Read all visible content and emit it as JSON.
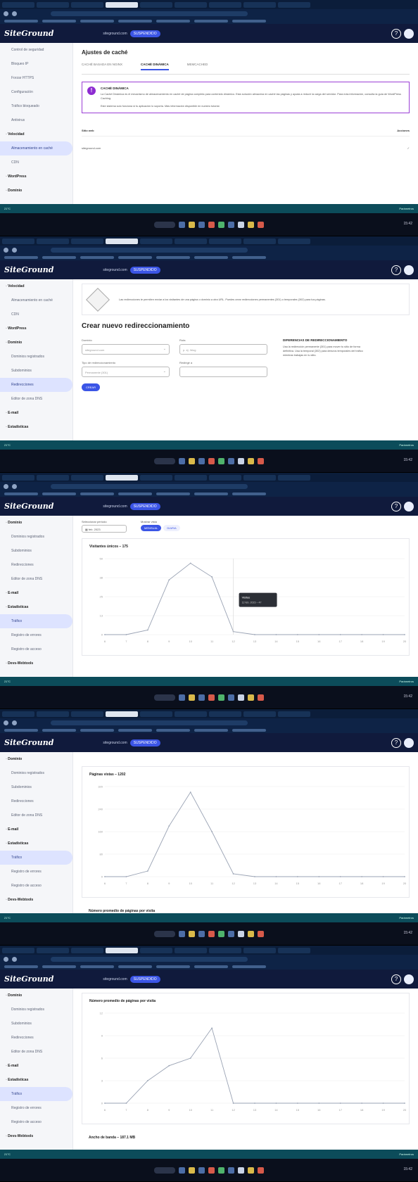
{
  "app": {
    "logo": "SiteGround",
    "site": "siteground.com",
    "site_badge": "SUSPENDIDO"
  },
  "taskbar": {
    "left_label": "21°C",
    "right_label": "Parámetros",
    "clock": "15:42"
  },
  "sidebar_frame1": [
    {
      "label": "Control de seguridad",
      "type": "item"
    },
    {
      "label": "Bloqueo IP",
      "type": "item"
    },
    {
      "label": "Forzar HTTPS",
      "type": "item"
    },
    {
      "label": "Configuración",
      "type": "item"
    },
    {
      "label": "Tráfico bloqueado",
      "type": "item"
    },
    {
      "label": "Antivirus",
      "type": "item"
    },
    {
      "label": "Velocidad",
      "type": "sec"
    },
    {
      "label": "Almacenamiento en caché",
      "type": "active"
    },
    {
      "label": "CDN",
      "type": "item"
    },
    {
      "label": "WordPress",
      "type": "sec"
    },
    {
      "label": "Dominio",
      "type": "sec"
    }
  ],
  "sidebar_frame2": [
    {
      "label": "Velocidad",
      "type": "sec"
    },
    {
      "label": "Almacenamiento en caché",
      "type": "item"
    },
    {
      "label": "CDN",
      "type": "item"
    },
    {
      "label": "WordPress",
      "type": "sec"
    },
    {
      "label": "Dominio",
      "type": "sec"
    },
    {
      "label": "Dominios registrados",
      "type": "item"
    },
    {
      "label": "Subdominios",
      "type": "item"
    },
    {
      "label": "Redirecciones",
      "type": "active"
    },
    {
      "label": "Editor de zona DNS",
      "type": "item"
    },
    {
      "label": "E-mail",
      "type": "sec"
    },
    {
      "label": "Estadísticas",
      "type": "sec"
    }
  ],
  "sidebar_stats": [
    {
      "label": "Dominio",
      "type": "sec"
    },
    {
      "label": "Dominios registrados",
      "type": "item"
    },
    {
      "label": "Subdominios",
      "type": "item"
    },
    {
      "label": "Redirecciones",
      "type": "item"
    },
    {
      "label": "Editor de zona DNS",
      "type": "item"
    },
    {
      "label": "E-mail",
      "type": "sec"
    },
    {
      "label": "Estadísticas",
      "type": "sec"
    },
    {
      "label": "Tráfico",
      "type": "active"
    },
    {
      "label": "Registro de errores",
      "type": "item"
    },
    {
      "label": "Registro de acceso",
      "type": "item"
    },
    {
      "label": "Devs-Webtools",
      "type": "sec"
    }
  ],
  "cache": {
    "title": "Ajustes de caché",
    "tabs": [
      "CACHÉ BASADA EN NGINX",
      "CACHÉ DINÁMICA",
      "MEMCACHED"
    ],
    "notice_title": "CACHÉ DINÁMICA",
    "notice_text": "La Caché Dinámica es el mecanismo de almacenamiento en caché de página completa para contenido dinámico. Esta solución almacena en caché las páginas y ayuda a reducir la carga del servidor. Para más información, consulta la guía de WordPress Caching.",
    "notice_text2": "Este sistema solo funciona si tu aplicación lo soporta. Más información disponible en nuestro tutorial.",
    "table_headers": [
      "Sitio web",
      "Acciones"
    ],
    "row": "siteground.com"
  },
  "redirect": {
    "banner_text": "Las redirecciones te permiten enviar a los visitantes de una página o dominio a otra URL. Puedes crear redirecciones permanentes (301) o temporales (302) para tus páginas.",
    "title": "Crear nuevo redireccionamiento",
    "domain_label": "Dominio",
    "domain_value": "siteground.com",
    "path_label": "Ruta",
    "path_placeholder": "p. ej. /blog",
    "type_label": "Tipo de redireccionamiento",
    "type_value": "Permanente (301)",
    "target_label": "Redirigir a",
    "button": "CREAR",
    "aside_title": "DIFERENCIAS DE REDIRECCIONAMIENTO",
    "aside_text": "Usa la redirección permanente (301) para mover tu sitio de forma definitiva. Usa la temporal (302) para desvíos temporales del tráfico mientras trabajas en tu sitio."
  },
  "traffic": {
    "period_label": "Seleccionar período",
    "period_value": "feb. 2023",
    "view_label": "Mostrar vista",
    "view_on": "MENSUAL",
    "view_off": "DIARIA",
    "visitors_title": "Visitantes únicos – 175",
    "tooltip_title": "Visitas",
    "tooltip_text": "12 feb. 2023 – 47",
    "pages_title": "Páginas vistas – 1202",
    "avg_title": "Número promedio de páginas por visita",
    "bandwidth_title": "Ancho de banda – 187.1 MB"
  },
  "chart_data": [
    {
      "type": "line",
      "title": "Visitantes únicos – 175",
      "x": [
        "6",
        "7",
        "8",
        "9",
        "10",
        "11",
        "12",
        "13",
        "14",
        "15",
        "16",
        "17",
        "18",
        "19",
        "20"
      ],
      "y": [
        0,
        0,
        3,
        36,
        47,
        38,
        2,
        0,
        0,
        0,
        0,
        0,
        0,
        0,
        0
      ],
      "ylim": [
        0,
        50
      ]
    },
    {
      "type": "line",
      "title": "Páginas vistas – 1202",
      "x": [
        "6",
        "7",
        "8",
        "9",
        "10",
        "11",
        "12",
        "13",
        "14",
        "15",
        "16",
        "17",
        "18",
        "19",
        "20"
      ],
      "y": [
        0,
        0,
        20,
        180,
        300,
        160,
        10,
        0,
        0,
        0,
        0,
        0,
        0,
        0,
        0
      ],
      "ylim": [
        0,
        320
      ]
    },
    {
      "type": "line",
      "title": "Número promedio de páginas por visita",
      "x": [
        "6",
        "7",
        "8",
        "9",
        "10",
        "11",
        "12",
        "13",
        "14",
        "15",
        "16",
        "17",
        "18",
        "19",
        "20"
      ],
      "y": [
        0,
        0,
        3,
        5,
        6,
        10,
        0,
        0,
        0,
        0,
        0,
        0,
        0,
        0,
        0
      ],
      "ylim": [
        0,
        12
      ]
    }
  ]
}
